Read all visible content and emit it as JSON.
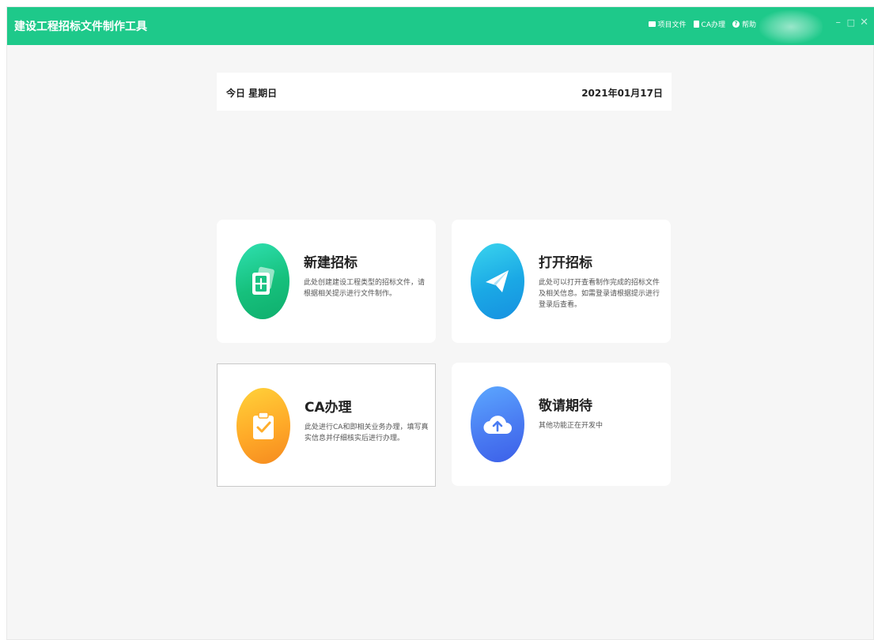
{
  "app": {
    "title": "建设工程招标文件制作工具",
    "actions": [
      {
        "label": "项目文件",
        "icon": "folder-icon"
      },
      {
        "label": "CA办理",
        "icon": "document-icon"
      },
      {
        "label": "帮助",
        "icon": "help-icon"
      }
    ],
    "window_controls": {
      "minimize": "–",
      "maximize": "□",
      "close": "✕"
    }
  },
  "date_bar": {
    "left": "今日 星期日",
    "right": "2021年01月17日"
  },
  "cards": [
    {
      "title": "新建招标",
      "desc": "此处创建建设工程类型的招标文件，请根据相关提示进行文件制作。",
      "icon": "new-file-icon",
      "color": "#16c07c"
    },
    {
      "title": "打开招标",
      "desc": "此处可以打开查看制作完成的招标文件及相关信息。如需登录请根据提示进行登录后查看。",
      "icon": "paper-plane-icon",
      "color": "#1aa8e5"
    },
    {
      "title": "CA办理",
      "desc": "此处进行CA和即相关业务办理，填写真实信息并仔细核实后进行办理。",
      "icon": "clipboard-check-icon",
      "color": "#ffaa28"
    },
    {
      "title": "敬请期待",
      "desc": "其他功能正在开发中",
      "icon": "cloud-upload-icon",
      "color": "#4a7cf2"
    }
  ]
}
